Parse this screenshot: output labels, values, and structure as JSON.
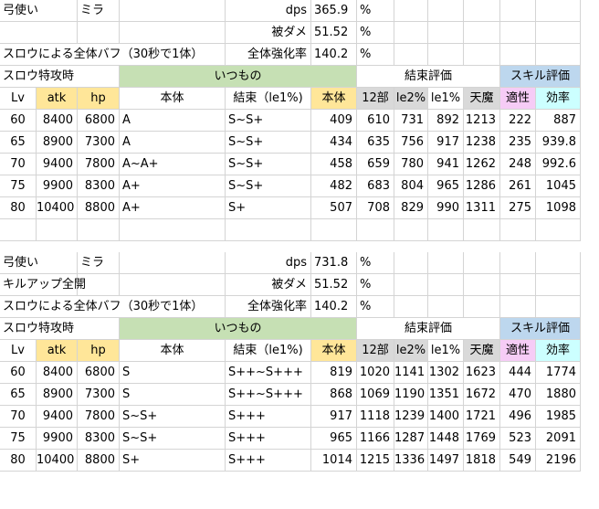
{
  "colors": {
    "green": "#c6e0b4",
    "orange": "#ffe699",
    "gray": "#d9d9d9",
    "blue": "#bdd7ee",
    "pink": "#f6ccf6",
    "cyan": "#ccffff",
    "grid": "#d4d4d4"
  },
  "sections": [
    {
      "info": [
        {
          "a": "弓使い",
          "b": "ミラ",
          "label": "dps",
          "value": "365.9",
          "unit": "%"
        },
        {
          "a": "",
          "b": "",
          "label": "被ダメ",
          "value": "51.52",
          "unit": "%"
        },
        {
          "a": "スロウによる全体バフ（30秒で1体）",
          "b": "",
          "label": "全体強化率",
          "value": "140.2",
          "unit": "%"
        }
      ],
      "group_header": {
        "title": "スロウ特攻時",
        "itsumono": "いつもの",
        "kessoku": "結束評価",
        "skill": "スキル評価"
      },
      "col_headers": [
        "Lv",
        "atk",
        "hp",
        "本体",
        "結束（le1%)",
        "本体",
        "12部",
        "le2%",
        "le1%",
        "天魔",
        "適性",
        "効率"
      ],
      "rows": [
        [
          "60",
          "8400",
          "6800",
          "A",
          "S~S+",
          "409",
          "610",
          "731",
          "892",
          "1213",
          "222",
          "887"
        ],
        [
          "65",
          "8900",
          "7300",
          "A",
          "S~S+",
          "434",
          "635",
          "756",
          "917",
          "1238",
          "235",
          "939.8"
        ],
        [
          "70",
          "9400",
          "7800",
          "A~A+",
          "S~S+",
          "458",
          "659",
          "780",
          "941",
          "1262",
          "248",
          "992.6"
        ],
        [
          "75",
          "9900",
          "8300",
          "A+",
          "S~S+",
          "482",
          "683",
          "804",
          "965",
          "1286",
          "261",
          "1045"
        ],
        [
          "80",
          "10400",
          "8800",
          "A+",
          "S+",
          "507",
          "708",
          "829",
          "990",
          "1311",
          "275",
          "1098"
        ]
      ]
    },
    {
      "info": [
        {
          "a": "弓使い",
          "b": "ミラ",
          "label": "dps",
          "value": "731.8",
          "unit": "%"
        },
        {
          "a": "キルアップ全開",
          "b": "",
          "label": "被ダメ",
          "value": "51.52",
          "unit": "%"
        },
        {
          "a": "スロウによる全体バフ（30秒で1体）",
          "b": "",
          "label": "全体強化率",
          "value": "140.2",
          "unit": "%"
        }
      ],
      "group_header": {
        "title": "スロウ特攻時",
        "itsumono": "いつもの",
        "kessoku": "結束評価",
        "skill": "スキル評価"
      },
      "col_headers": [
        "Lv",
        "atk",
        "hp",
        "本体",
        "結束（le1%)",
        "本体",
        "12部",
        "le2%",
        "le1%",
        "天魔",
        "適性",
        "効率"
      ],
      "rows": [
        [
          "60",
          "8400",
          "6800",
          "S",
          "S++~S+++",
          "819",
          "1020",
          "1141",
          "1302",
          "1623",
          "444",
          "1774"
        ],
        [
          "65",
          "8900",
          "7300",
          "S",
          "S++~S+++",
          "868",
          "1069",
          "1190",
          "1351",
          "1672",
          "470",
          "1880"
        ],
        [
          "70",
          "9400",
          "7800",
          "S~S+",
          "S+++",
          "917",
          "1118",
          "1239",
          "1400",
          "1721",
          "496",
          "1985"
        ],
        [
          "75",
          "9900",
          "8300",
          "S~S+",
          "S+++",
          "965",
          "1166",
          "1287",
          "1448",
          "1769",
          "523",
          "2091"
        ],
        [
          "80",
          "10400",
          "8800",
          "S+",
          "S+++",
          "1014",
          "1215",
          "1336",
          "1497",
          "1818",
          "549",
          "2196"
        ]
      ]
    }
  ]
}
